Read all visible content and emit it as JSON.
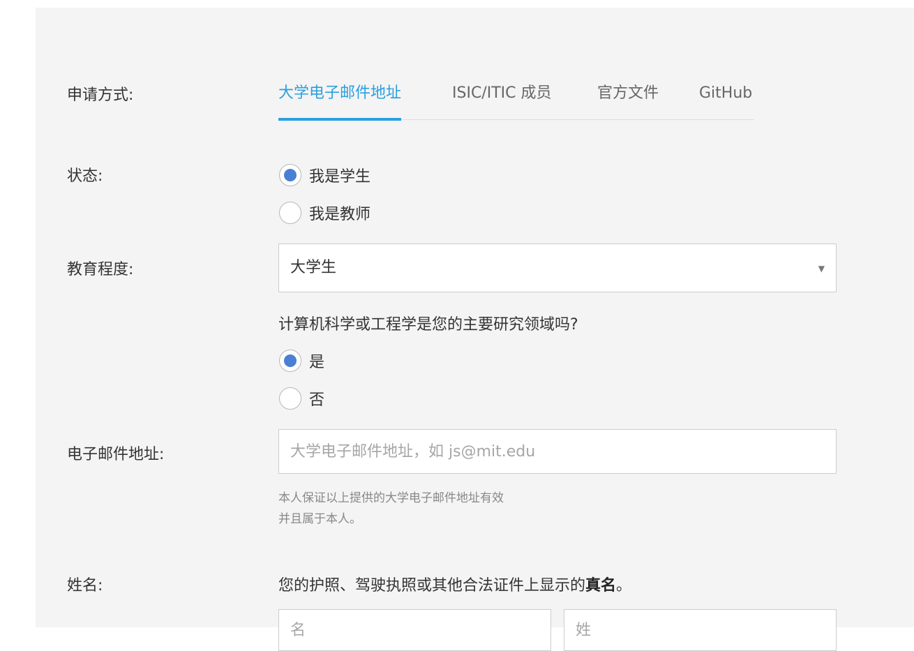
{
  "form": {
    "method": {
      "label": "申请方式:",
      "tabs": [
        {
          "label": "大学电子邮件地址",
          "active": true
        },
        {
          "label": "ISIC/ITIC 成员",
          "active": false
        },
        {
          "label": "官方文件",
          "active": false
        },
        {
          "label": "GitHub",
          "active": false
        }
      ]
    },
    "status": {
      "label": "状态:",
      "options": [
        {
          "label": "我是学生",
          "checked": true
        },
        {
          "label": "我是教师",
          "checked": false
        }
      ]
    },
    "education": {
      "label": "教育程度:",
      "selected": "大学生"
    },
    "cs_question": {
      "text": "计算机科学或工程学是您的主要研究领域吗?",
      "options": [
        {
          "label": "是",
          "checked": true
        },
        {
          "label": "否",
          "checked": false
        }
      ]
    },
    "email": {
      "label": "电子邮件地址:",
      "value": "",
      "placeholder": "大学电子邮件地址，如 js@mit.edu",
      "hint_line1": "本人保证以上提供的大学电子邮件地址有效",
      "hint_line2": "并且属于本人。"
    },
    "name": {
      "label": "姓名:",
      "desc_prefix": "您的护照、驾驶执照或其他合法证件上显示的",
      "desc_bold": "真名",
      "desc_suffix": "。",
      "first_placeholder": "名",
      "last_placeholder": "姓"
    }
  },
  "colors": {
    "accent": "#2a9fe0",
    "radio_checked": "#4a7fd4",
    "panel_bg": "#f4f4f4"
  },
  "icons": {
    "select_arrow": "chevron-down-icon"
  }
}
